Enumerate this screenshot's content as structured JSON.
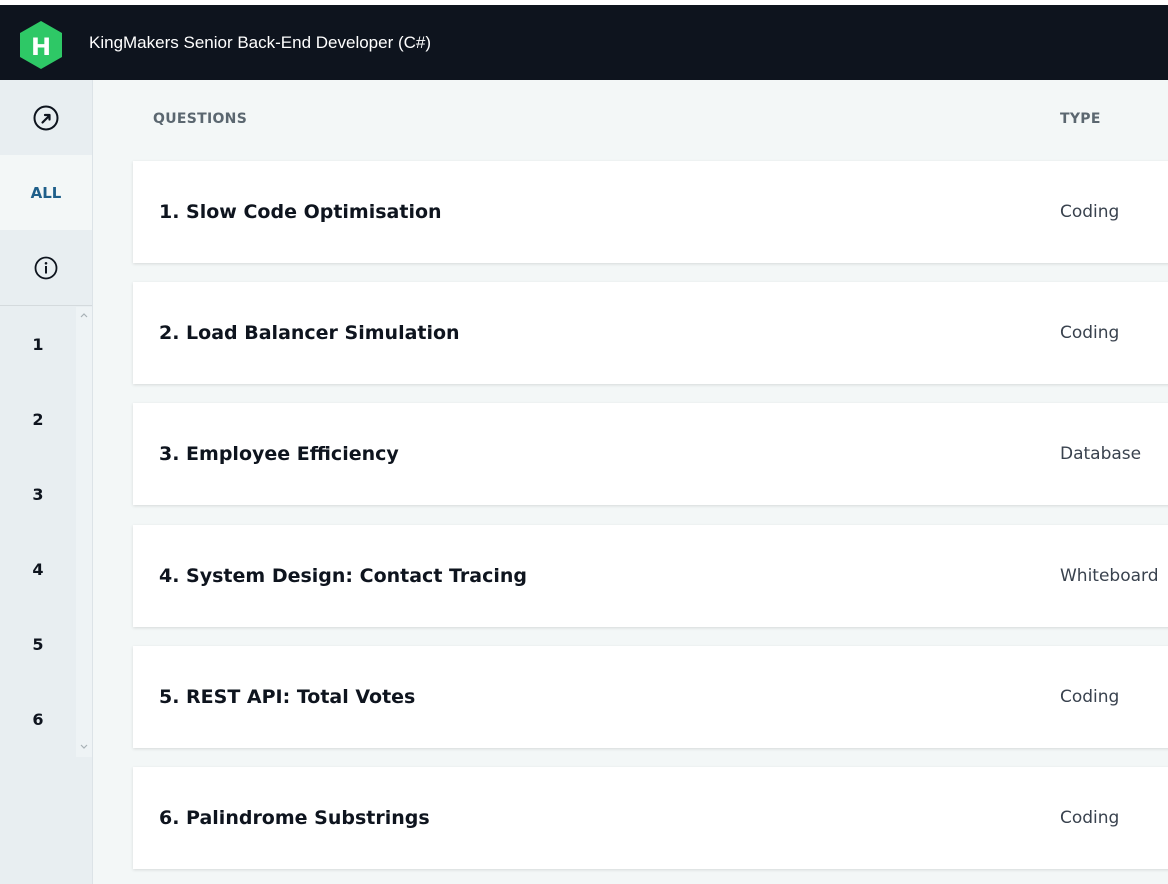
{
  "header": {
    "title": "KingMakers Senior Back-End Developer (C#)",
    "logo_letter": "H",
    "logo_color": "#2ec866"
  },
  "sidebar": {
    "top_icon": "external-link-icon",
    "all_label": "ALL",
    "info_icon": "info-icon",
    "numbers": [
      "1",
      "2",
      "3",
      "4",
      "5",
      "6"
    ]
  },
  "table": {
    "col_questions": "QUESTIONS",
    "col_type": "TYPE",
    "rows": [
      {
        "title": "1. Slow Code Optimisation",
        "type": "Coding"
      },
      {
        "title": "2. Load Balancer Simulation",
        "type": "Coding"
      },
      {
        "title": "3. Employee Efficiency",
        "type": "Database"
      },
      {
        "title": "4. System Design: Contact Tracing",
        "type": "Whiteboard"
      },
      {
        "title": "5. REST API: Total Votes",
        "type": "Coding"
      },
      {
        "title": "6. Palindrome Substrings",
        "type": "Coding"
      }
    ]
  },
  "colors": {
    "topbar": "#0e141e",
    "accent_blue": "#1f5f8a",
    "background": "#f3f7f7"
  }
}
